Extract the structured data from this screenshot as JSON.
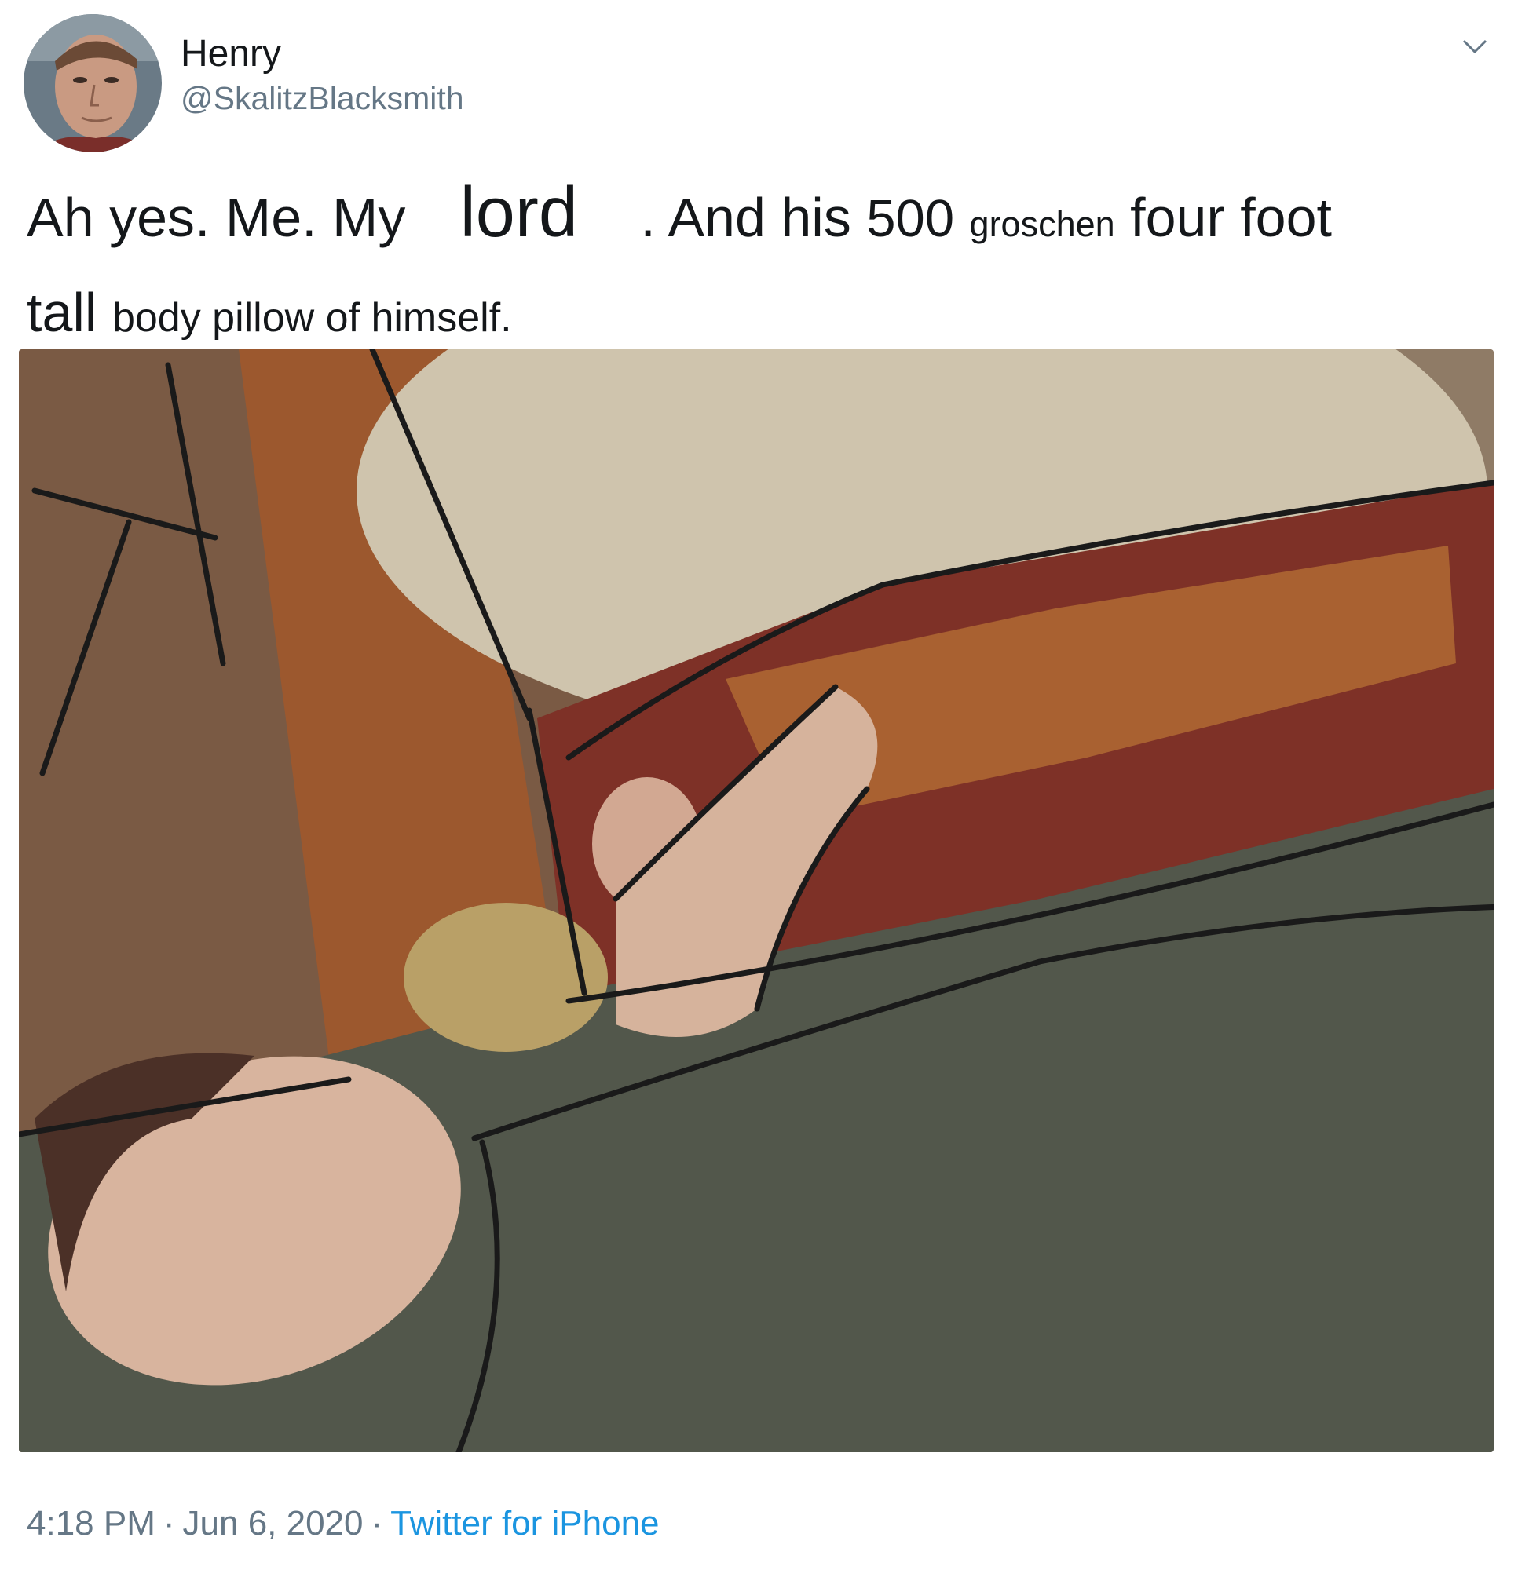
{
  "user": {
    "display_name": "Henry",
    "handle": "@SkalitzBlacksmith",
    "avatar_icon": "profile-photo"
  },
  "menu": {
    "icon": "chevron-down-icon"
  },
  "tweet": {
    "segments": [
      "Ah yes. Me. My",
      "lord",
      ". And his",
      "500",
      "groschen",
      "four foot",
      "tall",
      "body pillow of himself."
    ]
  },
  "media": {
    "type": "illustration"
  },
  "meta": {
    "time": "4:18 PM",
    "separator": "·",
    "date": "Jun 6, 2020",
    "source": "Twitter for iPhone"
  },
  "colors": {
    "text": "#14171a",
    "secondary": "#657786",
    "link": "#1b95e0"
  }
}
